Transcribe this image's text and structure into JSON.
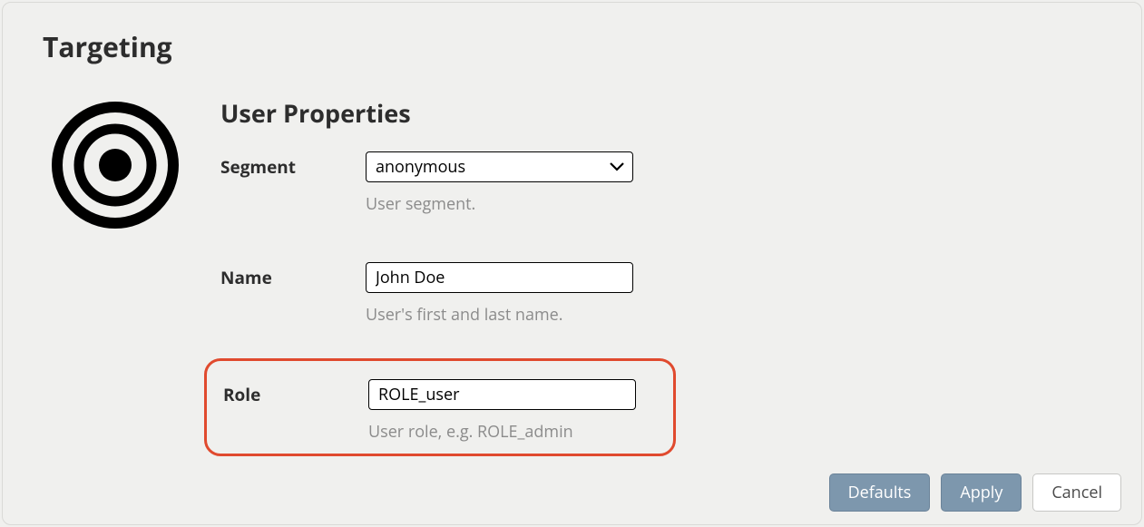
{
  "panel": {
    "title": "Targeting"
  },
  "section": {
    "title": "User Properties"
  },
  "fields": {
    "segment": {
      "label": "Segment",
      "value": "anonymous",
      "help": "User segment."
    },
    "name": {
      "label": "Name",
      "value": "John Doe",
      "help": "User's first and last name."
    },
    "role": {
      "label": "Role",
      "value": "ROLE_user",
      "help": "User role, e.g. ROLE_admin"
    }
  },
  "buttons": {
    "defaults": "Defaults",
    "apply": "Apply",
    "cancel": "Cancel"
  }
}
